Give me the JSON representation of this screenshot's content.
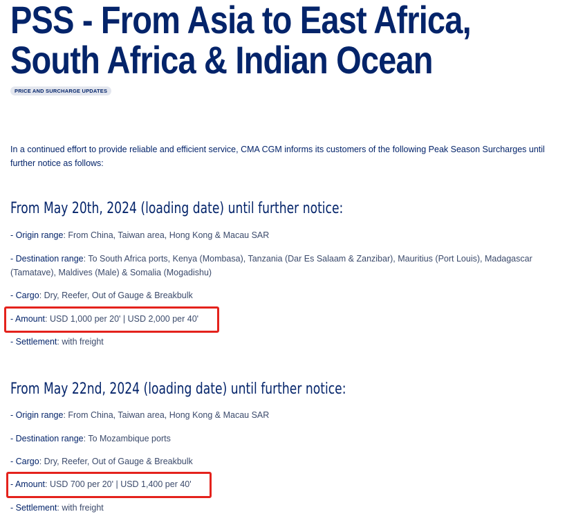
{
  "title": "PSS - From Asia to East Africa, South Africa & Indian Ocean",
  "tag": "PRICE AND SURCHARGE UPDATES",
  "intro": "In a continued effort to provide reliable and efficient service, CMA CGM informs its customers of the following Peak Season Surcharges until further notice as follows:",
  "sections": [
    {
      "heading": "From May 20th, 2024 (loading date) until further notice:",
      "origin_label": "- Origin range",
      "origin_value": ": From China, Taiwan area, Hong Kong & Macau SAR",
      "dest_label": "- Destination range",
      "dest_value": ": To South Africa ports, Kenya (Mombasa), Tanzania (Dar Es Salaam & Zanzibar), Mauritius (Port Louis), Madagascar (Tamatave), Maldives (Male) & Somalia (Mogadishu)",
      "cargo_label": "- Cargo",
      "cargo_value": ": Dry, Reefer, Out of Gauge & Breakbulk",
      "amount_label": "- Amount",
      "amount_value": ": USD 1,000 per 20' | USD 2,000 per 40'",
      "settlement_label": "- Settlement",
      "settlement_value": ": with freight"
    },
    {
      "heading": "From May 22nd, 2024 (loading date) until further notice:",
      "origin_label": "- Origin range",
      "origin_value": ": From China, Taiwan area, Hong Kong & Macau SAR",
      "dest_label": "- Destination range",
      "dest_value": ": To Mozambique ports",
      "cargo_label": "- Cargo",
      "cargo_value": ": Dry, Reefer, Out of Gauge & Breakbulk",
      "amount_label": "- Amount",
      "amount_value": ": USD 700 per 20' | USD 1,400 per 40'",
      "settlement_label": "- Settlement",
      "settlement_value": ": with freight"
    }
  ],
  "colors": {
    "text": "#04246a",
    "highlight": "#e4221c",
    "tag_bg": "#e3e6ee"
  }
}
